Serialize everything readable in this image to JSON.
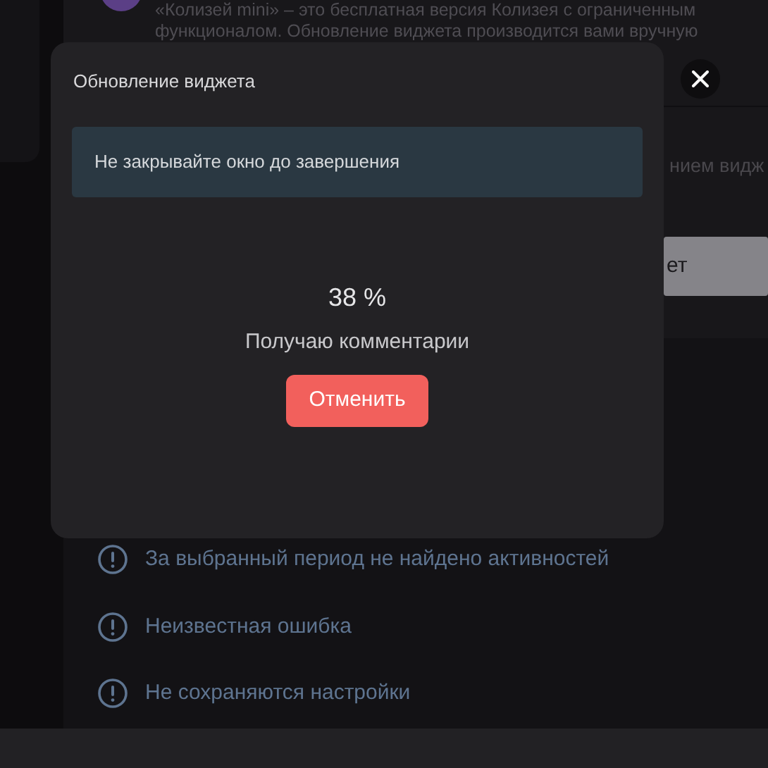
{
  "background": {
    "description": [
      "«Колизей mini» – это бесплатная версия Колизея с ограниченным",
      "функционалом. Обновление виджета производится вами вручную"
    ],
    "hint_fragment": "нием видж",
    "button_fragment": "ет",
    "issues": [
      {
        "text": "За выбранный период не найдено активностей"
      },
      {
        "text": "Неизвестная ошибка"
      },
      {
        "text": "Не сохраняются настройки"
      }
    ]
  },
  "dialog": {
    "title": "Обновление виджета",
    "notice": "Не закрывайте окно до завершения",
    "progress": "38 %",
    "status": "Получаю комментарии",
    "cancel": "Отменить"
  }
}
